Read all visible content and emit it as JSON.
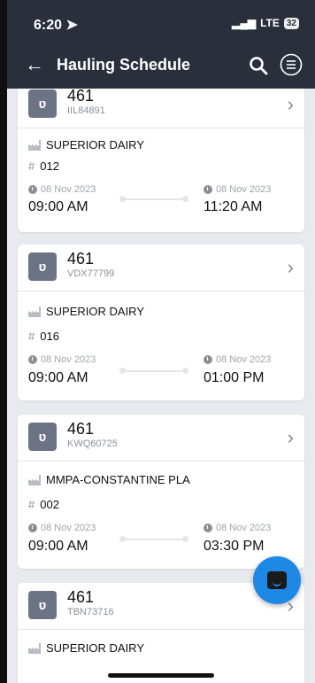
{
  "status_bar": {
    "time": "6:20",
    "network": "LTE",
    "battery": "32"
  },
  "header": {
    "title": "Hauling Schedule"
  },
  "schedule": [
    {
      "route": "461",
      "plate": "IIL84891",
      "plant": "SUPERIOR DAIRY",
      "number": "012",
      "start_date": "08 Nov 2023",
      "start_time": "09:00 AM",
      "end_date": "08 Nov 2023",
      "end_time": "11:20 AM"
    },
    {
      "route": "461",
      "plate": "VDX77799",
      "plant": "SUPERIOR DAIRY",
      "number": "016",
      "start_date": "08 Nov 2023",
      "start_time": "09:00 AM",
      "end_date": "08 Nov 2023",
      "end_time": "01:00 PM"
    },
    {
      "route": "461",
      "plate": "KWQ60725",
      "plant": "MMPA-CONSTANTINE PLA",
      "number": "002",
      "start_date": "08 Nov 2023",
      "start_time": "09:00 AM",
      "end_date": "08 Nov 2023",
      "end_time": "03:30 PM"
    },
    {
      "route": "461",
      "plate": "TBN73716",
      "plant": "SUPERIOR DAIRY"
    }
  ]
}
